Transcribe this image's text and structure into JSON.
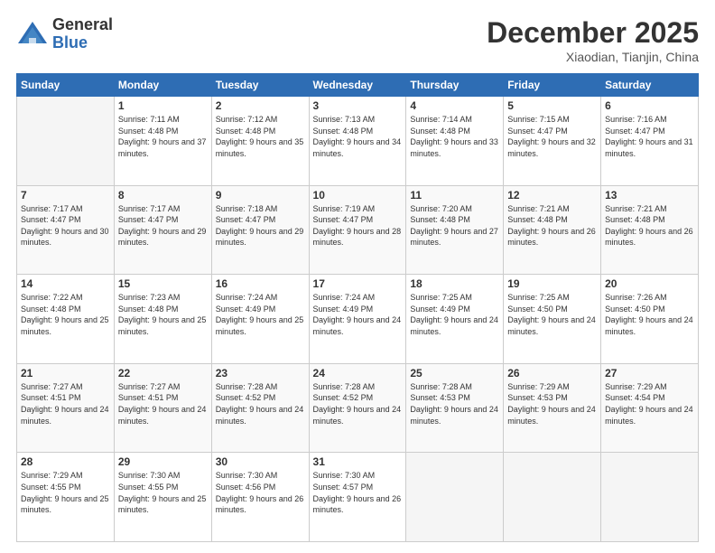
{
  "logo": {
    "general": "General",
    "blue": "Blue"
  },
  "header": {
    "month": "December 2025",
    "location": "Xiaodian, Tianjin, China"
  },
  "weekdays": [
    "Sunday",
    "Monday",
    "Tuesday",
    "Wednesday",
    "Thursday",
    "Friday",
    "Saturday"
  ],
  "weeks": [
    [
      {
        "day": "",
        "empty": true
      },
      {
        "day": "1",
        "sunrise": "7:11 AM",
        "sunset": "4:48 PM",
        "daylight": "9 hours and 37 minutes."
      },
      {
        "day": "2",
        "sunrise": "7:12 AM",
        "sunset": "4:48 PM",
        "daylight": "9 hours and 35 minutes."
      },
      {
        "day": "3",
        "sunrise": "7:13 AM",
        "sunset": "4:48 PM",
        "daylight": "9 hours and 34 minutes."
      },
      {
        "day": "4",
        "sunrise": "7:14 AM",
        "sunset": "4:48 PM",
        "daylight": "9 hours and 33 minutes."
      },
      {
        "day": "5",
        "sunrise": "7:15 AM",
        "sunset": "4:47 PM",
        "daylight": "9 hours and 32 minutes."
      },
      {
        "day": "6",
        "sunrise": "7:16 AM",
        "sunset": "4:47 PM",
        "daylight": "9 hours and 31 minutes."
      }
    ],
    [
      {
        "day": "7",
        "sunrise": "7:17 AM",
        "sunset": "4:47 PM",
        "daylight": "9 hours and 30 minutes."
      },
      {
        "day": "8",
        "sunrise": "7:17 AM",
        "sunset": "4:47 PM",
        "daylight": "9 hours and 29 minutes."
      },
      {
        "day": "9",
        "sunrise": "7:18 AM",
        "sunset": "4:47 PM",
        "daylight": "9 hours and 29 minutes."
      },
      {
        "day": "10",
        "sunrise": "7:19 AM",
        "sunset": "4:47 PM",
        "daylight": "9 hours and 28 minutes."
      },
      {
        "day": "11",
        "sunrise": "7:20 AM",
        "sunset": "4:48 PM",
        "daylight": "9 hours and 27 minutes."
      },
      {
        "day": "12",
        "sunrise": "7:21 AM",
        "sunset": "4:48 PM",
        "daylight": "9 hours and 26 minutes."
      },
      {
        "day": "13",
        "sunrise": "7:21 AM",
        "sunset": "4:48 PM",
        "daylight": "9 hours and 26 minutes."
      }
    ],
    [
      {
        "day": "14",
        "sunrise": "7:22 AM",
        "sunset": "4:48 PM",
        "daylight": "9 hours and 25 minutes."
      },
      {
        "day": "15",
        "sunrise": "7:23 AM",
        "sunset": "4:48 PM",
        "daylight": "9 hours and 25 minutes."
      },
      {
        "day": "16",
        "sunrise": "7:24 AM",
        "sunset": "4:49 PM",
        "daylight": "9 hours and 25 minutes."
      },
      {
        "day": "17",
        "sunrise": "7:24 AM",
        "sunset": "4:49 PM",
        "daylight": "9 hours and 24 minutes."
      },
      {
        "day": "18",
        "sunrise": "7:25 AM",
        "sunset": "4:49 PM",
        "daylight": "9 hours and 24 minutes."
      },
      {
        "day": "19",
        "sunrise": "7:25 AM",
        "sunset": "4:50 PM",
        "daylight": "9 hours and 24 minutes."
      },
      {
        "day": "20",
        "sunrise": "7:26 AM",
        "sunset": "4:50 PM",
        "daylight": "9 hours and 24 minutes."
      }
    ],
    [
      {
        "day": "21",
        "sunrise": "7:27 AM",
        "sunset": "4:51 PM",
        "daylight": "9 hours and 24 minutes."
      },
      {
        "day": "22",
        "sunrise": "7:27 AM",
        "sunset": "4:51 PM",
        "daylight": "9 hours and 24 minutes."
      },
      {
        "day": "23",
        "sunrise": "7:28 AM",
        "sunset": "4:52 PM",
        "daylight": "9 hours and 24 minutes."
      },
      {
        "day": "24",
        "sunrise": "7:28 AM",
        "sunset": "4:52 PM",
        "daylight": "9 hours and 24 minutes."
      },
      {
        "day": "25",
        "sunrise": "7:28 AM",
        "sunset": "4:53 PM",
        "daylight": "9 hours and 24 minutes."
      },
      {
        "day": "26",
        "sunrise": "7:29 AM",
        "sunset": "4:53 PM",
        "daylight": "9 hours and 24 minutes."
      },
      {
        "day": "27",
        "sunrise": "7:29 AM",
        "sunset": "4:54 PM",
        "daylight": "9 hours and 24 minutes."
      }
    ],
    [
      {
        "day": "28",
        "sunrise": "7:29 AM",
        "sunset": "4:55 PM",
        "daylight": "9 hours and 25 minutes."
      },
      {
        "day": "29",
        "sunrise": "7:30 AM",
        "sunset": "4:55 PM",
        "daylight": "9 hours and 25 minutes."
      },
      {
        "day": "30",
        "sunrise": "7:30 AM",
        "sunset": "4:56 PM",
        "daylight": "9 hours and 26 minutes."
      },
      {
        "day": "31",
        "sunrise": "7:30 AM",
        "sunset": "4:57 PM",
        "daylight": "9 hours and 26 minutes."
      },
      {
        "day": "",
        "empty": true
      },
      {
        "day": "",
        "empty": true
      },
      {
        "day": "",
        "empty": true
      }
    ]
  ]
}
